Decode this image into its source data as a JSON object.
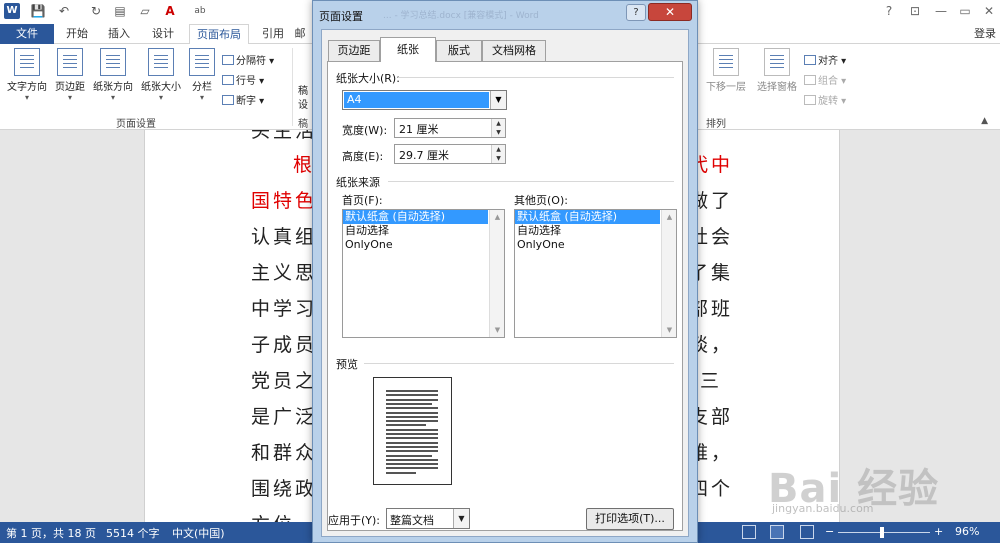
{
  "window": {
    "title_ghost": "... - 学习总结.docx [兼容模式] - Word",
    "logo": "W",
    "qat": [
      "save",
      "undo",
      "redo",
      "new",
      "open",
      "font-color",
      "abc"
    ]
  },
  "ribbon": {
    "file_tab": "文件",
    "tabs": [
      "开始",
      "插入",
      "设计",
      "页面布局",
      "引用",
      "邮"
    ],
    "active_tab": "页面布局",
    "signin": "登录",
    "page_setup_group": {
      "label": "页面设置",
      "big_buttons": [
        "文字方向",
        "页边距",
        "纸张方向",
        "纸张大小",
        "分栏"
      ],
      "small_buttons": [
        "分隔符",
        "行号",
        "断字"
      ]
    },
    "partial_group": {
      "lines": [
        "稿",
        "设"
      ],
      "label": "稿"
    },
    "arrange_group": {
      "label": "排列",
      "big_buttons": [
        "下移一层",
        "选择窗格"
      ],
      "small_buttons": [
        "对齐",
        "组合",
        "旋转"
      ]
    }
  },
  "document": {
    "lines": [
      {
        "left": "头生活",
        "right": ""
      },
      {
        "left": "根",
        "right": "代中",
        "red": true
      },
      {
        "left": "国特色",
        "right": "",
        "red": true
      },
      {
        "left": "认真组",
        "right": "做了"
      },
      {
        "left": "",
        "right": "社会"
      },
      {
        "left": "主义思",
        "right": "了集"
      },
      {
        "left": "中学习",
        "right": "部班"
      },
      {
        "left": "子成员",
        "right": "谈，"
      },
      {
        "left": "党员之",
        "right": "三"
      },
      {
        "left": "是广泛",
        "right": "支部"
      },
      {
        "left": "和群众",
        "right": "难，"
      },
      {
        "left": "围绕政",
        "right": "四个"
      },
      {
        "left": "方位",
        "right": ""
      }
    ],
    "right_line_3_prefix": "：",
    "red_color": "#e00000"
  },
  "dialog": {
    "title": "页面设置",
    "help": "?",
    "close": "✕",
    "tabs": [
      "页边距",
      "纸张",
      "版式",
      "文档网格"
    ],
    "active_tab": "纸张",
    "paper_size": {
      "section": "纸张大小(R):",
      "value": "A4",
      "width_label": "宽度(W):",
      "width_value": "21 厘米",
      "height_label": "高度(E):",
      "height_value": "29.7 厘米"
    },
    "paper_source": {
      "section": "纸张来源",
      "first_page_label": "首页(F):",
      "other_pages_label": "其他页(O):",
      "first_page_items": [
        "默认纸盒 (自动选择)",
        "自动选择",
        "OnlyOne"
      ],
      "other_pages_items": [
        "默认纸盒 (自动选择)",
        "自动选择",
        "OnlyOne"
      ],
      "selected_index": 0
    },
    "preview": {
      "section": "预览"
    },
    "apply_to": {
      "label": "应用于(Y):",
      "value": "整篇文档"
    },
    "print_options": "打印选项(T)..."
  },
  "statusbar": {
    "page": "第 1 页，共 18 页",
    "words": "5514 个字",
    "language": "中文(中国)",
    "zoom_minus": "−",
    "zoom_plus": "+",
    "zoom": "96%",
    "zoom_fraction": 0.48
  },
  "watermark": {
    "main": "Bai 经验",
    "url": "jingyan.baidu.com"
  },
  "colors": {
    "accent": "#2b579a",
    "selection": "#3399ff",
    "dialog_frame": "#b9d1ea",
    "close": "#c7463c"
  }
}
